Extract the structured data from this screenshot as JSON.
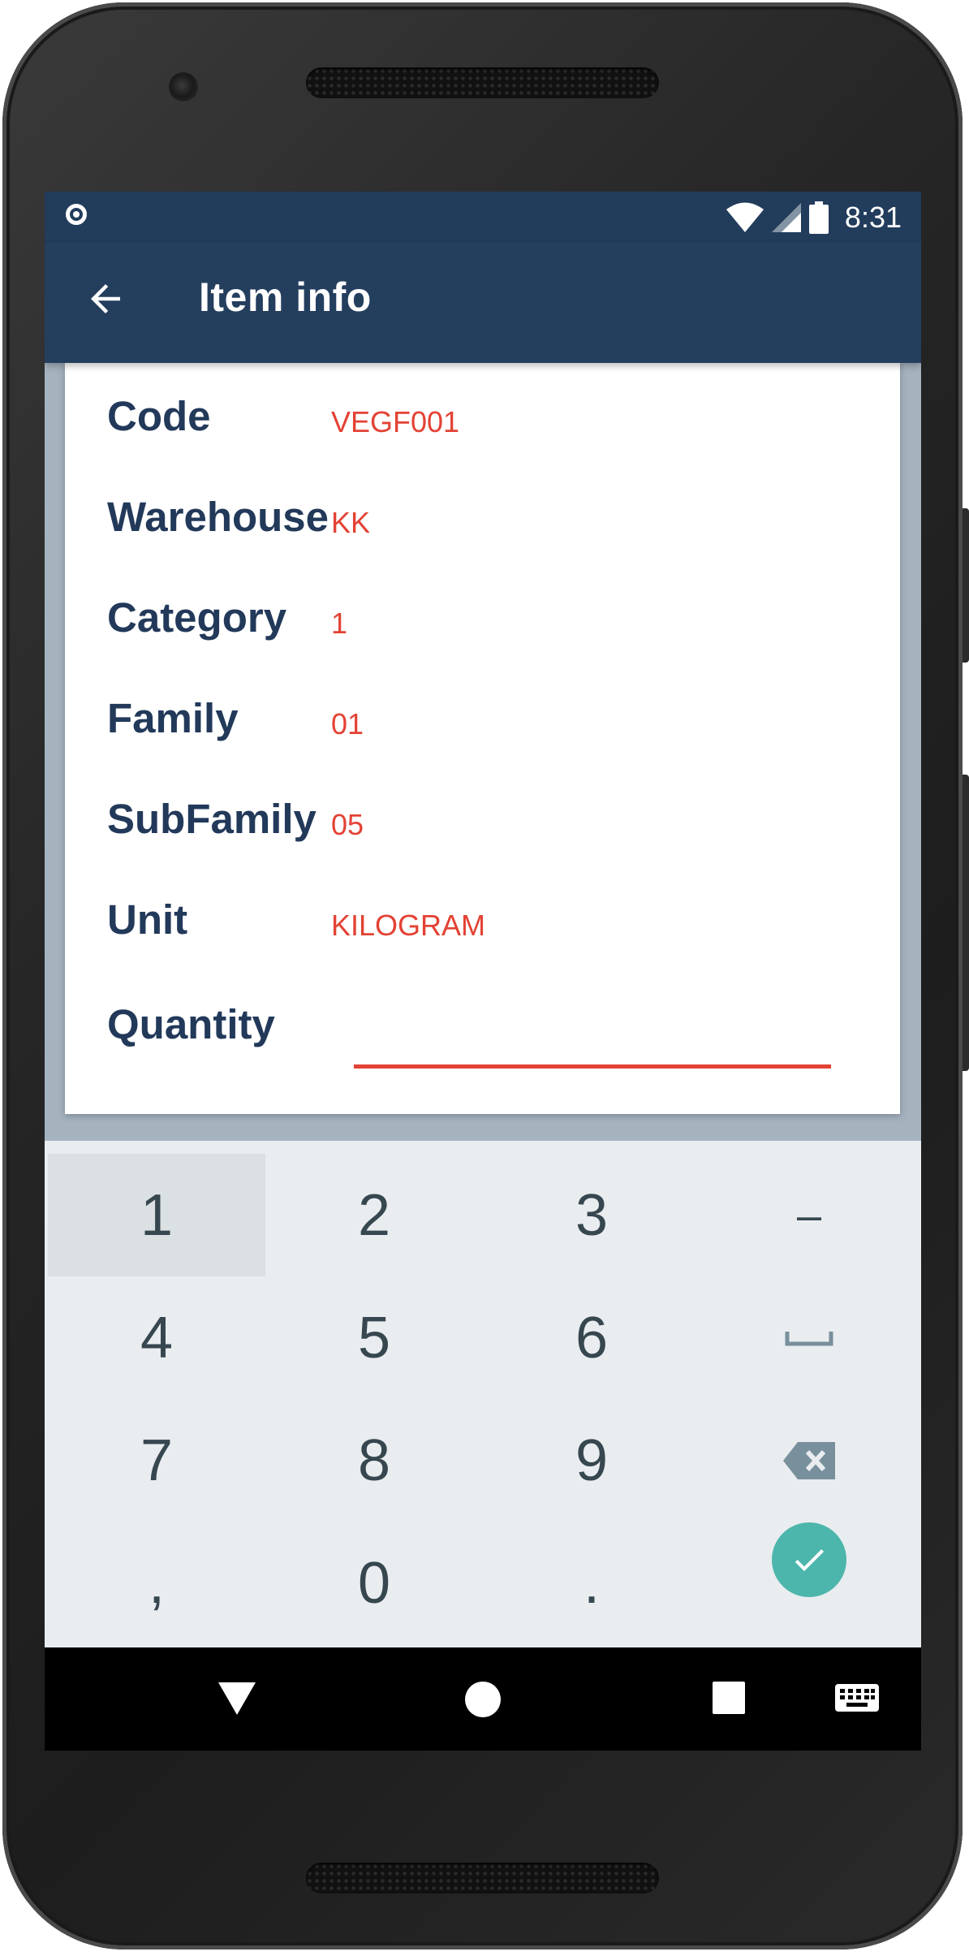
{
  "status_bar": {
    "time": "8:31"
  },
  "app_bar": {
    "title": "Item info"
  },
  "item": {
    "fields": [
      {
        "label": "Code",
        "value": "VEGF001"
      },
      {
        "label": "Warehouse",
        "value": "KK"
      },
      {
        "label": "Category",
        "value": "1"
      },
      {
        "label": "Family",
        "value": "01"
      },
      {
        "label": "SubFamily",
        "value": "05"
      },
      {
        "label": "Unit",
        "value": "KILOGRAM"
      }
    ],
    "quantity": {
      "label": "Quantity",
      "value": ""
    }
  },
  "keyboard": {
    "keys": [
      "1",
      "2",
      "3",
      "–",
      "4",
      "5",
      "6",
      "␣",
      "7",
      "8",
      "9",
      "⌫",
      ",",
      "0",
      ".",
      "✓"
    ],
    "accent_color": "#4db6ac"
  },
  "colors": {
    "app_bar": "#243e5e",
    "label": "#22395a",
    "value": "#e34234"
  },
  "nav_bar": {
    "icons": [
      "back-icon",
      "home-icon",
      "recents-icon",
      "keyboard-icon"
    ]
  }
}
